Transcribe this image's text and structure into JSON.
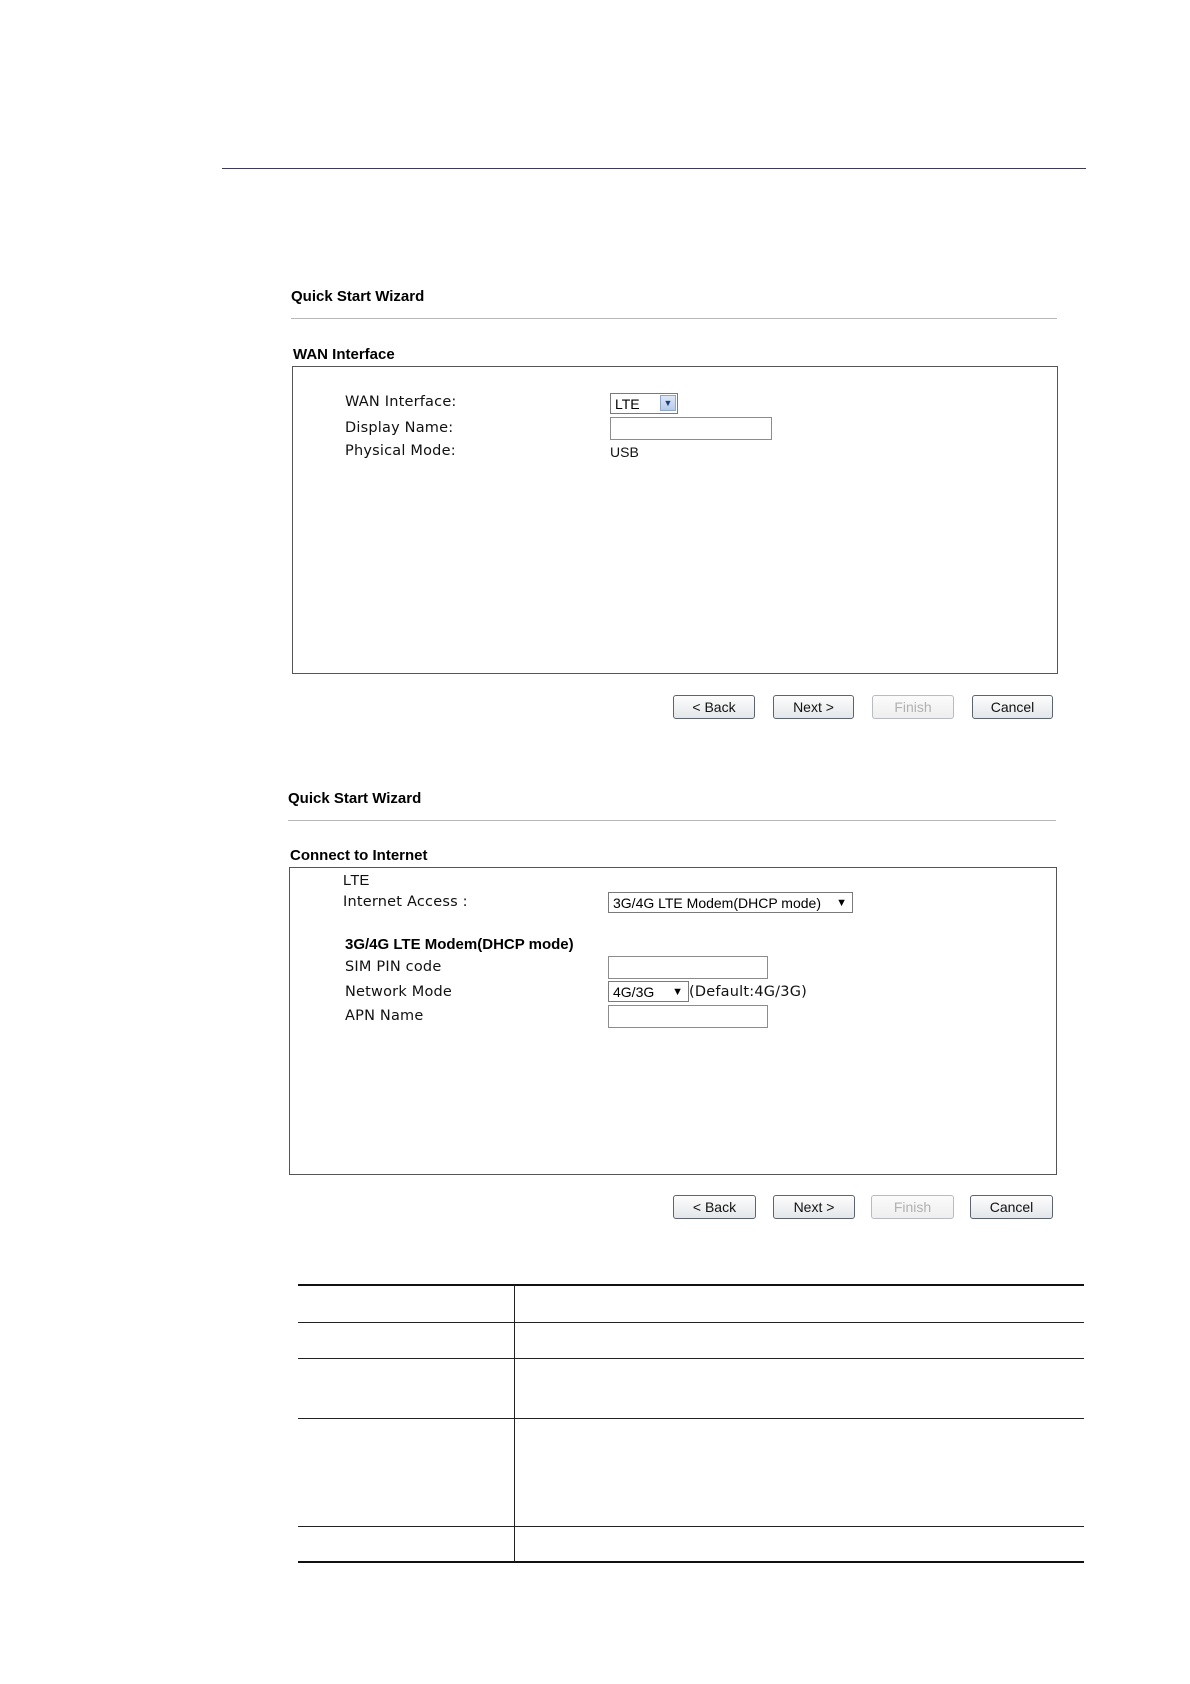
{
  "wizard1": {
    "title": "Quick Start Wizard",
    "section_title": "WAN Interface",
    "fields": {
      "wan_interface_label": "WAN Interface:",
      "wan_interface_value": "LTE",
      "display_name_label": "Display Name:",
      "display_name_value": "",
      "physical_mode_label": "Physical Mode:",
      "physical_mode_value": "USB"
    },
    "buttons": {
      "back": "< Back",
      "next": "Next >",
      "finish": "Finish",
      "cancel": "Cancel"
    }
  },
  "wizard2": {
    "title": "Quick Start Wizard",
    "section_title": "Connect to Internet",
    "interface_name": "LTE",
    "internet_access_label": "Internet Access :",
    "internet_access_value": "3G/4G LTE Modem(DHCP mode)",
    "mode_heading": "3G/4G LTE Modem(DHCP mode)",
    "sim_pin_label": "SIM PIN code",
    "sim_pin_value": "",
    "network_mode_label": "Network Mode",
    "network_mode_value": "4G/3G",
    "network_mode_default": "(Default:4G/3G)",
    "apn_name_label": "APN Name",
    "apn_name_value": "",
    "buttons": {
      "back": "< Back",
      "next": "Next >",
      "finish": "Finish",
      "cancel": "Cancel"
    }
  },
  "icons": {
    "dropdown": "chevron-down-icon",
    "dropdown_plain": "triangle-down-icon"
  }
}
